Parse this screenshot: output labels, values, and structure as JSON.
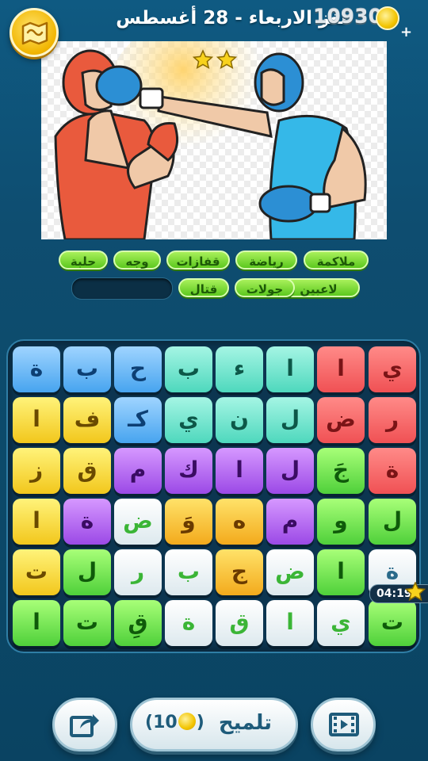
{
  "header": {
    "title": "لغز الاربعاء - 28 أغسطس",
    "coins": "10930",
    "map_icon": "map-icon",
    "coin_icon": "coin-icon",
    "plus": "+"
  },
  "picture": {
    "stars": 2
  },
  "words": [
    {
      "text": "ملاكمة"
    },
    {
      "text": "رياضة"
    },
    {
      "text": "قفازات"
    },
    {
      "text": "وجه"
    },
    {
      "text": "حلبة"
    },
    {
      "text": "لاعبين"
    },
    {
      "text": "جولات"
    },
    {
      "text": "قتال"
    }
  ],
  "board": {
    "rows": [
      [
        {
          "l": "ي",
          "c": "red"
        },
        {
          "l": "ا",
          "c": "red"
        },
        {
          "l": "ا",
          "c": "teal"
        },
        {
          "l": "ء",
          "c": "teal"
        },
        {
          "l": "ب",
          "c": "teal"
        },
        {
          "l": "ح",
          "c": "blue"
        },
        {
          "l": "ب",
          "c": "blue"
        },
        {
          "l": "ة",
          "c": "blue"
        }
      ],
      [
        {
          "l": "ر",
          "c": "red"
        },
        {
          "l": "ض",
          "c": "red"
        },
        {
          "l": "ل",
          "c": "teal"
        },
        {
          "l": "ن",
          "c": "teal"
        },
        {
          "l": "ي",
          "c": "teal"
        },
        {
          "l": "كـ",
          "c": "blue"
        },
        {
          "l": "ف",
          "c": "yellow"
        },
        {
          "l": "ا",
          "c": "yellow"
        }
      ],
      [
        {
          "l": "ة",
          "c": "red"
        },
        {
          "l": "جَ",
          "c": "green"
        },
        {
          "l": "ل",
          "c": "purple"
        },
        {
          "l": "ا",
          "c": "purple"
        },
        {
          "l": "ك",
          "c": "purple"
        },
        {
          "l": "م",
          "c": "purple"
        },
        {
          "l": "ق",
          "c": "yellow"
        },
        {
          "l": "ز",
          "c": "yellow"
        }
      ],
      [
        {
          "l": "ل",
          "c": "green"
        },
        {
          "l": "و",
          "c": "green"
        },
        {
          "l": "م",
          "c": "purple"
        },
        {
          "l": "ه",
          "c": "orange"
        },
        {
          "l": "وَ",
          "c": "orange"
        },
        {
          "l": "ض",
          "c": "white-g"
        },
        {
          "l": "ة",
          "c": "purple"
        },
        {
          "l": "ا",
          "c": "yellow"
        }
      ],
      [
        {
          "l": "ة",
          "c": "white"
        },
        {
          "l": "ا",
          "c": "green"
        },
        {
          "l": "ض",
          "c": "white-g"
        },
        {
          "l": "ج",
          "c": "orange"
        },
        {
          "l": "ب",
          "c": "white-g"
        },
        {
          "l": "ر",
          "c": "white-g"
        },
        {
          "l": "ل",
          "c": "green"
        },
        {
          "l": "ت",
          "c": "yellow"
        }
      ],
      [
        {
          "l": "ت",
          "c": "green"
        },
        {
          "l": "ي",
          "c": "white-g"
        },
        {
          "l": "ا",
          "c": "white-g"
        },
        {
          "l": "ق",
          "c": "white-g"
        },
        {
          "l": "ة",
          "c": "white-g"
        },
        {
          "l": "قِ",
          "c": "green"
        },
        {
          "l": "ت",
          "c": "green"
        },
        {
          "l": "ا",
          "c": "green"
        }
      ]
    ]
  },
  "timer": "04:19",
  "buttons": {
    "share_icon": "share-icon",
    "hint_label": "تلميح",
    "hint_cost": "10",
    "video_icon": "video-icon"
  }
}
